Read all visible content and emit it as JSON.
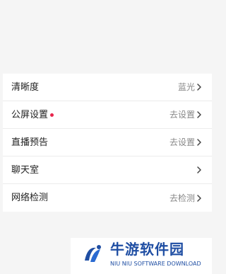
{
  "settings": [
    {
      "label": "清晰度",
      "value": "蓝光",
      "dot": false
    },
    {
      "label": "公屏设置",
      "value": "去设置",
      "dot": true
    },
    {
      "label": "直播预告",
      "value": "去设置",
      "dot": false
    },
    {
      "label": "聊天室",
      "value": "",
      "dot": false
    },
    {
      "label": "网络检测",
      "value": "去检测",
      "dot": false
    }
  ],
  "watermark": {
    "title": "牛游软件园",
    "subtitle": "NIU NIU SOFTWARE DOWNLOAD"
  },
  "colors": {
    "accent_dot": "#e8264d",
    "brand_blue": "#1f4ea3"
  }
}
